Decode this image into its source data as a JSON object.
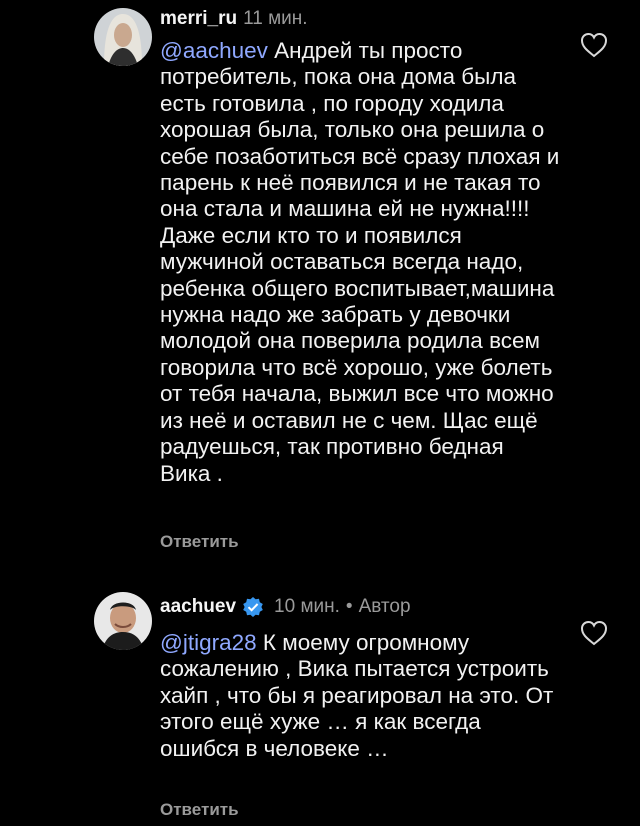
{
  "comments": [
    {
      "username": "merri_ru",
      "time": "11 мин.",
      "mention": "@aachuev",
      "text": " Андрей ты просто потребитель, пока она дома была есть готовила , по городу ходила хорошая была, только она решила о себе позаботиться всё сразу плохая и парень к неё появился и не такая то она стала и машина ей не нужна!!!! Даже если кто то и появился мужчиной оставаться всегда надо, ребенка общего воспитывает,машина нужна надо же забрать у девочки молодой она поверила родила всем говорила что всё хорошо, уже болеть от тебя начала,  выжил все что можно из неё и оставил не с чем. Щас ещё радуешься, так противно бедная Вика .",
      "reply": "Ответить",
      "avatar_icon": "user-avatar-blonde",
      "like_icon": "heart-outline-icon"
    },
    {
      "username": "aachuev",
      "time": "10 мин.",
      "separator": "•",
      "author_badge": "Автор",
      "mention": "@jtigra28",
      "text": " К моему огромному сожалению , Вика пытается устроить хайп , что бы я реагировал на это. От этого ещё хуже … я как всегда ошибся в человеке …",
      "reply": "Ответить",
      "avatar_icon": "user-avatar-man",
      "verified_icon": "verified-badge-icon",
      "like_icon": "heart-outline-icon"
    }
  ],
  "colors": {
    "background": "#000000",
    "mention": "#8fa8ff",
    "meta": "#9a9a9a",
    "verified": "#3897f0"
  }
}
